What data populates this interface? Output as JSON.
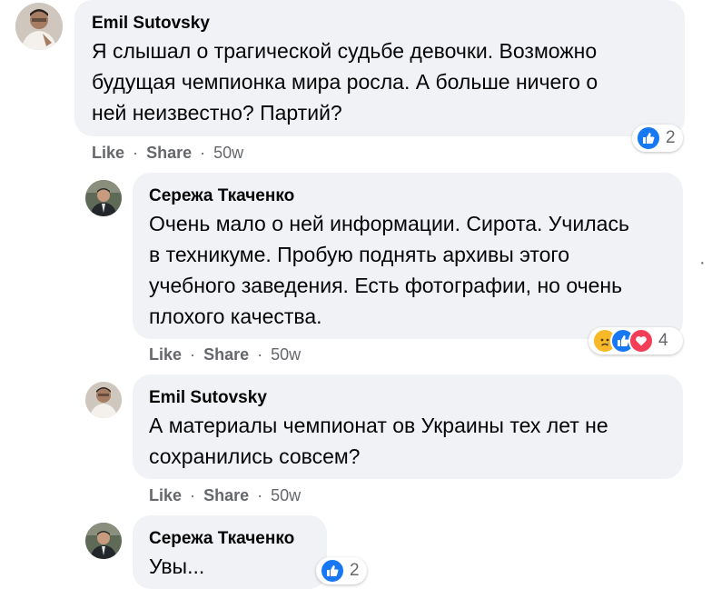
{
  "comments": [
    {
      "author": "Emil Sutovsky",
      "lines": [
        "Я слышал о трагической судьбе девочки. Возможно",
        "будущая чемпионка мира росла. А больше ничего о",
        "ней неизвестно? Партий?"
      ],
      "like": "Like",
      "share": "Share",
      "time": "50w",
      "reaction_count": "2"
    },
    {
      "author": "Сережа Ткаченко",
      "lines": [
        "Очень мало о ней информации. Сирота. Училась",
        "в техникуме. Пробую поднять архивы этого",
        "учебного заведения. Есть фотографии, но очень",
        "плохого качества."
      ],
      "like": "Like",
      "share": "Share",
      "time": "50w",
      "reaction_count": "4"
    },
    {
      "author": "Emil Sutovsky",
      "lines": [
        "А материалы чемпионат ов Украины тех лет не",
        "сохранились совсем?"
      ],
      "like": "Like",
      "share": "Share",
      "time": "50w"
    },
    {
      "author": "Сережа Ткаченко",
      "lines": [
        "Увы..."
      ],
      "reaction_count": "2"
    }
  ],
  "separator": "·",
  "more_glyph": "·",
  "icons": {
    "like": "thumbs-up-icon",
    "sad": "sad-face-icon",
    "love": "heart-icon",
    "more": "more-options-icon"
  },
  "colors": {
    "like_blue": "#1877f2",
    "love_red": "#f33e58",
    "sad_yellow": "#f7b928",
    "bubble": "#f0f2f5",
    "meta": "#65676b"
  }
}
